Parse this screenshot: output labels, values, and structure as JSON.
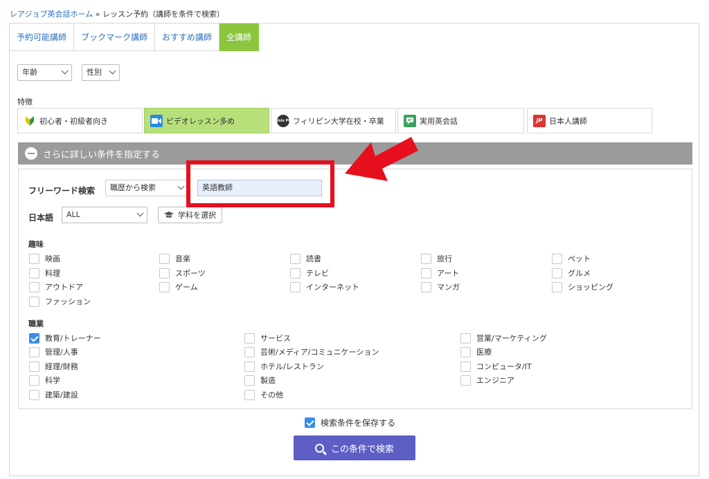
{
  "breadcrumb": {
    "home": "レアジョブ英会話ホーム",
    "separator": " » ",
    "current": "レッスン予約（講師を条件で検索）"
  },
  "tabs": [
    "予約可能講師",
    "ブックマーク講師",
    "おすすめ講師",
    "全講師"
  ],
  "filters": {
    "age": "年齢",
    "gender": "性別"
  },
  "features": {
    "heading": "特徴",
    "items": [
      "初心者・初級者向き",
      "ビデオレッスン多め",
      "フィリピン大学在校・卒業",
      "実用英会話",
      "日本人講師"
    ],
    "icon_texts": [
      "",
      "",
      "Univ Ph",
      "",
      "JP"
    ]
  },
  "detail_bar": "さらに詳しい条件を指定する",
  "freeword": {
    "label": "フリーワード検索",
    "scope": "職歴から検索",
    "value": "英語教師"
  },
  "japanese": {
    "label": "日本語",
    "value": "ALL",
    "subject_button": "学科を選択"
  },
  "hobbies": {
    "heading": "趣味",
    "items": [
      "映画",
      "音楽",
      "読書",
      "旅行",
      "ペット",
      "料理",
      "スポーツ",
      "テレビ",
      "アート",
      "グルメ",
      "アウトドア",
      "ゲーム",
      "インターネット",
      "マンガ",
      "ショッピング",
      "ファッション"
    ]
  },
  "occupations": {
    "heading": "職業",
    "items": [
      "教育/トレーナー",
      "サービス",
      "営業/マーケティング",
      "管理/人事",
      "芸術/メディア/コミュニケーション",
      "医療",
      "経理/財務",
      "ホテル/レストラン",
      "コンピュータ/IT",
      "科学",
      "製造",
      "エンジニア",
      "建築/建設",
      "その他"
    ],
    "checked": [
      "教育/トレーナー"
    ]
  },
  "save_conditions": {
    "label": "検索条件を保存する",
    "checked": true
  },
  "search_button": "この条件で検索",
  "colors": {
    "tab_active": "#8cc63f",
    "feature_active": "#b7e07a",
    "link": "#2a6fbd",
    "search_button": "#5d5fc4",
    "highlight": "#e60f1e"
  }
}
